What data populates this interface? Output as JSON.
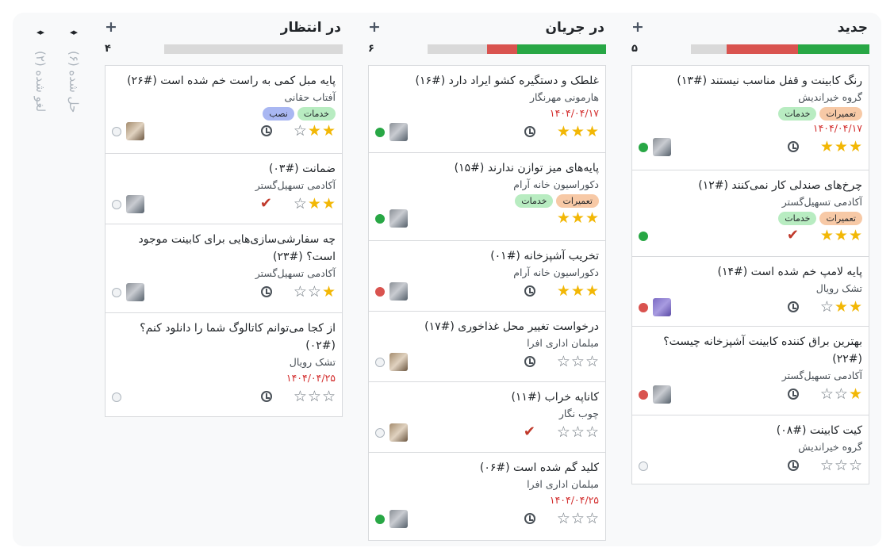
{
  "columns": {
    "new": {
      "title": "جدید",
      "count": "۵",
      "cards": [
        {
          "title": "رنگ کابینت و قفل مناسب نیستند (#۱۳)",
          "partner": "گروه خیراندیش",
          "tags": [
            "تعمیرات",
            "خدمات"
          ],
          "date": "۱۴۰۴/۰۴/۱۷",
          "stars": 3
        },
        {
          "title": "چرخ‌های صندلی کار نمی‌کنند (#۱۲)",
          "partner": "آکادمی تسهیل‌گستر",
          "tags": [
            "تعمیرات",
            "خدمات"
          ],
          "stars": 3
        },
        {
          "title": "پایه لامپ خم شده است (#۱۴)",
          "partner": "تشک رویال",
          "stars": 2
        },
        {
          "title": "بهترین براق کننده کابینت آشپزخانه چیست؟ (#۲۲)",
          "partner": "آکادمی تسهیل‌گستر",
          "stars": 1
        },
        {
          "title": "کیت کابینت (#۰۸)",
          "partner": "گروه خیراندیش",
          "stars": 0
        }
      ]
    },
    "in_progress": {
      "title": "در جریان",
      "count": "۶",
      "cards": [
        {
          "title": "غلطک و دستگیره کشو ایراد دارد (#۱۶)",
          "partner": "هارمونی مهرنگار",
          "date": "۱۴۰۴/۰۴/۱۷",
          "stars": 3
        },
        {
          "title": "پایه‌های میز توازن ندارند (#۱۵)",
          "partner": "دکوراسیون خانه آرام",
          "tags": [
            "تعمیرات",
            "خدمات"
          ],
          "stars": 3
        },
        {
          "title": "تخریب آشپزخانه (#۰۱)",
          "partner": "دکوراسیون خانه آرام",
          "stars": 3
        },
        {
          "title": "درخواست تغییر محل غذاخوری (#۱۷)",
          "partner": "مبلمان اداری افرا",
          "stars": 0
        },
        {
          "title": "کاناپه خراب (#۱۱)",
          "partner": "چوب نگار",
          "stars": 0
        },
        {
          "title": "کلید گم شده است (#۰۶)",
          "partner": "مبلمان اداری افرا",
          "date": "۱۴۰۴/۰۴/۲۵",
          "stars": 0
        }
      ]
    },
    "waiting": {
      "title": "در انتظار",
      "count": "۴",
      "cards": [
        {
          "title": "پایه مبل کمی به راست خم شده است (#۲۶)",
          "partner": "آفتاب حقانی",
          "tags": [
            "خدمات",
            "نصب"
          ],
          "stars": 2
        },
        {
          "title": "ضمانت (#۰۳)",
          "partner": "آکادمی تسهیل‌گستر",
          "stars": 2
        },
        {
          "title": "چه سفارشی‌سازی‌هایی برای کابینت موجود است؟ (#۲۳)",
          "partner": "آکادمی تسهیل‌گستر",
          "stars": 1
        },
        {
          "title": "از کجا می‌توانم کاتالوگ شما را دانلود کنم؟ (#۰۲)",
          "partner": "تشک رویال",
          "date": "۱۴۰۴/۰۴/۲۵",
          "stars": 0
        }
      ]
    }
  },
  "folded": {
    "solved": "حل شده (۶)",
    "cancelled": "لغو شده (۲)",
    "arrows": "◂▸"
  },
  "add_symbol": "+",
  "progress_colors": {
    "green": "#28a745",
    "red": "#d9534f",
    "grey": "#d9d9d9"
  }
}
